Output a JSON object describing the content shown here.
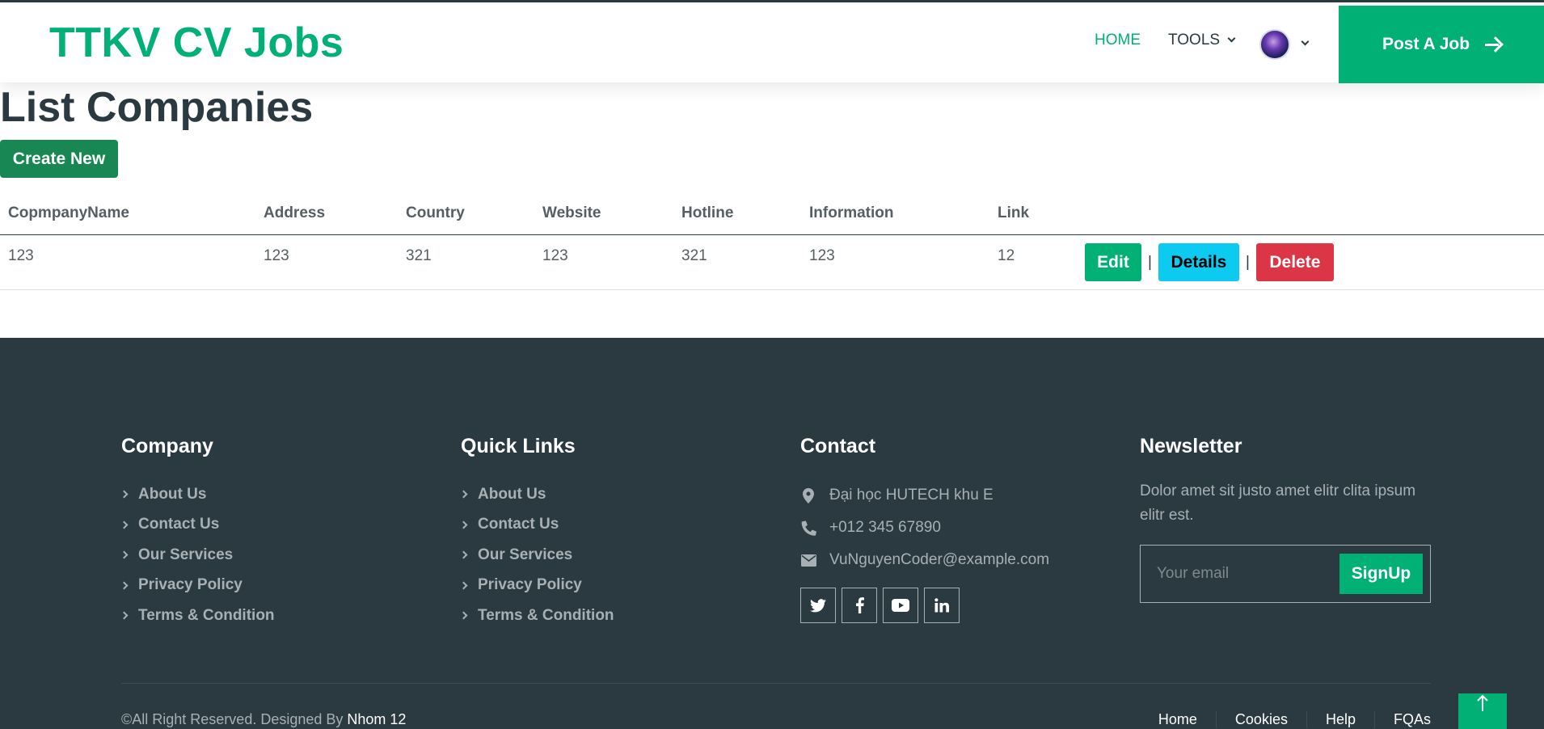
{
  "navbar": {
    "brand": "TTKV CV Jobs",
    "home": "HOME",
    "tools": "TOOLS",
    "post_job": "Post A Job"
  },
  "main": {
    "title": "List Companies",
    "create_new": "Create New",
    "table": {
      "headers": [
        "CopmpanyName",
        "Address",
        "Country",
        "Website",
        "Hotline",
        "Information",
        "Link"
      ],
      "rows": [
        [
          "123",
          "123",
          "321",
          "123",
          "321",
          "123",
          "12"
        ]
      ],
      "actions": {
        "edit": "Edit",
        "details": "Details",
        "delete": "Delete",
        "separator": "|"
      }
    }
  },
  "footer": {
    "company": {
      "heading": "Company",
      "links": [
        "About Us",
        "Contact Us",
        "Our Services",
        "Privacy Policy",
        "Terms & Condition"
      ]
    },
    "quick_links": {
      "heading": "Quick Links",
      "links": [
        "About Us",
        "Contact Us",
        "Our Services",
        "Privacy Policy",
        "Terms & Condition"
      ]
    },
    "contact": {
      "heading": "Contact",
      "address": "Đại học HUTECH khu E",
      "phone": "+012 345 67890",
      "email": "VuNguyenCoder@example.com",
      "socials": [
        "twitter-icon",
        "facebook-icon",
        "youtube-icon",
        "linkedin-icon"
      ]
    },
    "newsletter": {
      "heading": "Newsletter",
      "text": "Dolor amet sit justo amet elitr clita ipsum elitr est.",
      "placeholder": "Your email",
      "signup": "SignUp"
    },
    "copyright": "©All Right Reserved. Designed By",
    "designer": "Nhom 12",
    "nav": [
      "Home",
      "Cookies",
      "Help",
      "FQAs"
    ]
  },
  "colors": {
    "accent": "#00b074",
    "dark": "#2b3940",
    "create_btn": "#198754",
    "details_btn": "#0dcaf0",
    "delete_btn": "#dc3545"
  }
}
